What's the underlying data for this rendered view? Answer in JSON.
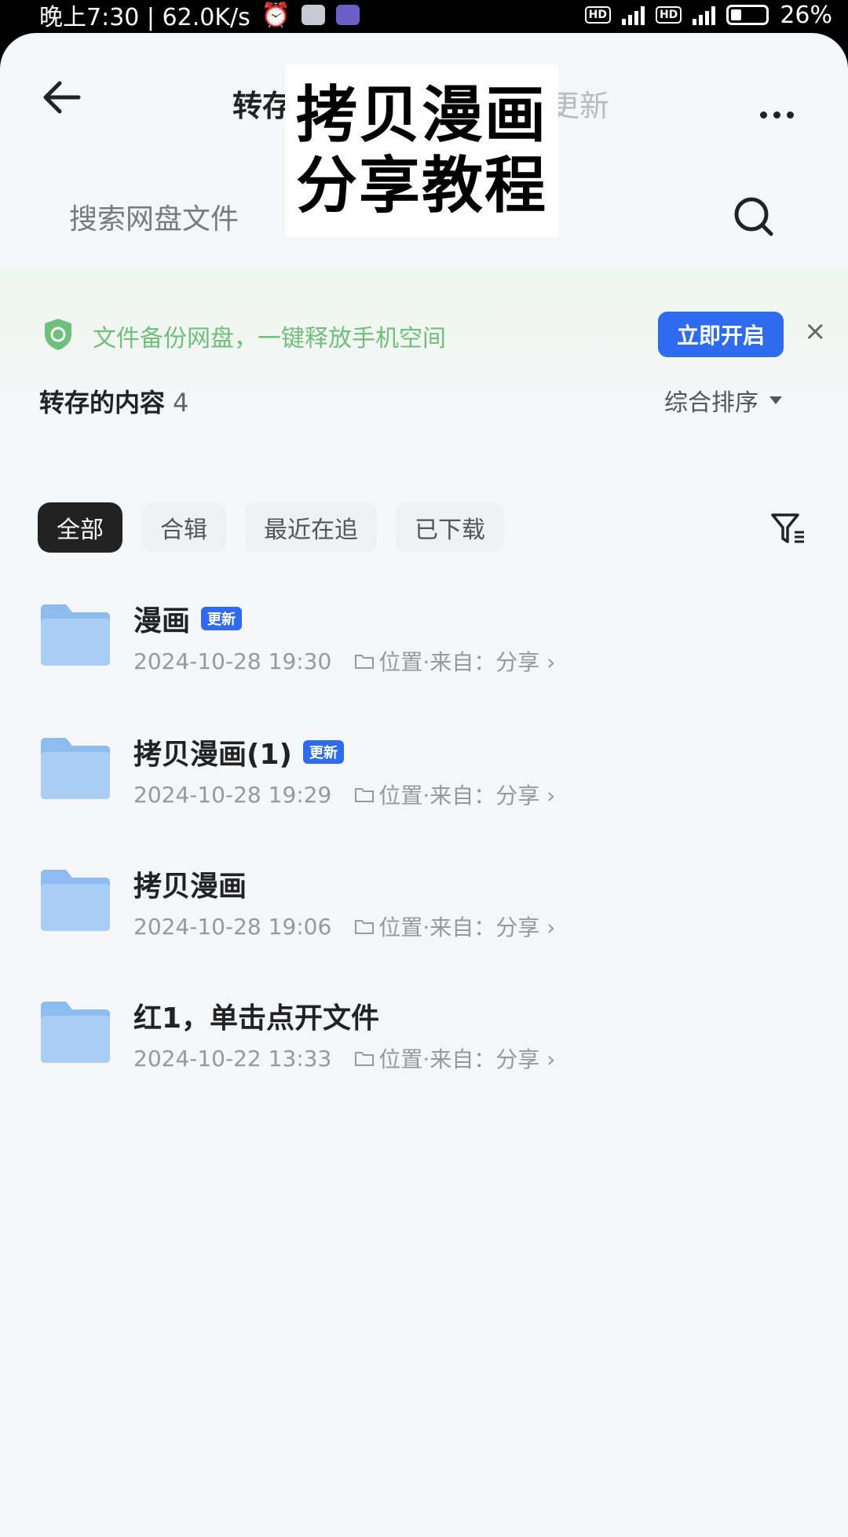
{
  "status_bar": {
    "time_speed": "晚上7:30 | 62.0K/s",
    "battery": "26%"
  },
  "header": {
    "title_left": "转存",
    "title_right": "更新"
  },
  "overlay": {
    "line1": "拷贝漫画",
    "line2": "分享教程"
  },
  "search": {
    "placeholder": "搜索网盘文件"
  },
  "banner": {
    "text": "文件备份网盘，一键释放手机空间",
    "button": "立即开启",
    "close": "×"
  },
  "section": {
    "title": "转存的内容",
    "count": "4",
    "sort_label": "综合排序"
  },
  "tabs": [
    "全部",
    "合辑",
    "最近在追",
    "已下载"
  ],
  "files": [
    {
      "name": "漫画",
      "badge": "更新",
      "date": "2024-10-28 19:30",
      "location": "位置·来自：分享 ›"
    },
    {
      "name": "拷贝漫画(1)",
      "badge": "更新",
      "date": "2024-10-28 19:29",
      "location": "位置·来自：分享 ›"
    },
    {
      "name": "拷贝漫画",
      "badge": "",
      "date": "2024-10-28 19:06",
      "location": "位置·来自：分享 ›"
    },
    {
      "name": "红1，单击点开文件",
      "badge": "",
      "date": "2024-10-22 13:33",
      "location": "位置·来自：分享 ›"
    }
  ],
  "colors": {
    "accent": "#2f6bf0",
    "banner_green": "#6fc07a",
    "folder_blue": "#8fbcf0"
  }
}
